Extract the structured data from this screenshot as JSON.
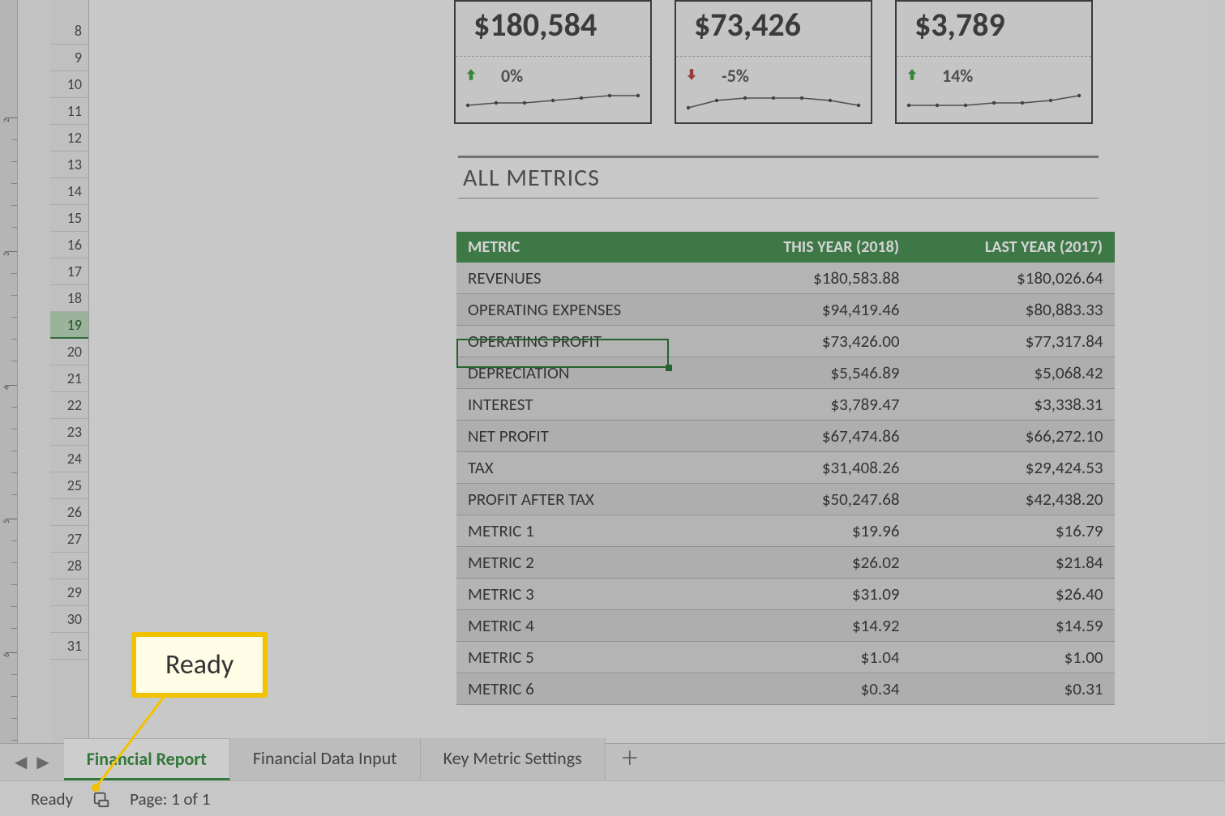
{
  "kpis": [
    {
      "value": "$180,584",
      "change": "0%",
      "direction": "up"
    },
    {
      "value": "$73,426",
      "change": "-5%",
      "direction": "down"
    },
    {
      "value": "$3,789",
      "change": "14%",
      "direction": "up"
    }
  ],
  "section_title": "ALL METRICS",
  "table": {
    "headers": {
      "metric": "METRIC",
      "this_year": "THIS YEAR (2018)",
      "last_year": "LAST YEAR (2017)"
    },
    "rows": [
      {
        "metric": "REVENUES",
        "this_year": "$180,583.88",
        "last_year": "$180,026.64"
      },
      {
        "metric": "OPERATING  EXPENSES",
        "this_year": "$94,419.46",
        "last_year": "$80,883.33"
      },
      {
        "metric": "OPERATING  PROFIT",
        "this_year": "$73,426.00",
        "last_year": "$77,317.84"
      },
      {
        "metric": "DEPRECIATION",
        "this_year": "$5,546.89",
        "last_year": "$5,068.42"
      },
      {
        "metric": "INTEREST",
        "this_year": "$3,789.47",
        "last_year": "$3,338.31"
      },
      {
        "metric": "NET  PROFIT",
        "this_year": "$67,474.86",
        "last_year": "$66,272.10"
      },
      {
        "metric": "TAX",
        "this_year": "$31,408.26",
        "last_year": "$29,424.53"
      },
      {
        "metric": "PROFIT  AFTER  TAX",
        "this_year": "$50,247.68",
        "last_year": "$42,438.20"
      },
      {
        "metric": "METRIC  1",
        "this_year": "$19.96",
        "last_year": "$16.79"
      },
      {
        "metric": "METRIC  2",
        "this_year": "$26.02",
        "last_year": "$21.84"
      },
      {
        "metric": "METRIC  3",
        "this_year": "$31.09",
        "last_year": "$26.40"
      },
      {
        "metric": "METRIC  4",
        "this_year": "$14.92",
        "last_year": "$14.59"
      },
      {
        "metric": "METRIC  5",
        "this_year": "$1.04",
        "last_year": "$1.00"
      },
      {
        "metric": "METRIC  6",
        "this_year": "$0.34",
        "last_year": "$0.31"
      }
    ]
  },
  "row_headers": [
    8,
    9,
    10,
    11,
    12,
    13,
    14,
    15,
    16,
    17,
    18,
    19,
    20,
    21,
    22,
    23,
    24,
    25,
    26,
    27,
    28,
    29,
    30,
    31
  ],
  "selected_row": 19,
  "ruler_marks": [
    2,
    3,
    4,
    5,
    6
  ],
  "tabs": [
    {
      "label": "Financial Report",
      "active": true
    },
    {
      "label": "Financial Data Input",
      "active": false
    },
    {
      "label": "Key Metric Settings",
      "active": false
    }
  ],
  "status": {
    "ready": "Ready",
    "page": "Page: 1 of 1"
  },
  "callout": {
    "text": "Ready"
  },
  "chart_data": [
    {
      "type": "line",
      "title": "KPI 1 sparkline",
      "x": [
        1,
        2,
        3,
        4,
        5,
        6,
        7
      ],
      "values": [
        10,
        11,
        11,
        12,
        13,
        14,
        14
      ],
      "ylim": [
        8,
        16
      ]
    },
    {
      "type": "line",
      "title": "KPI 2 sparkline",
      "x": [
        1,
        2,
        3,
        4,
        5,
        6,
        7
      ],
      "values": [
        9,
        12,
        13,
        13,
        13,
        12,
        10
      ],
      "ylim": [
        8,
        16
      ]
    },
    {
      "type": "line",
      "title": "KPI 3 sparkline",
      "x": [
        1,
        2,
        3,
        4,
        5,
        6,
        7
      ],
      "values": [
        10,
        10,
        10,
        11,
        11,
        12,
        14
      ],
      "ylim": [
        8,
        16
      ]
    }
  ]
}
